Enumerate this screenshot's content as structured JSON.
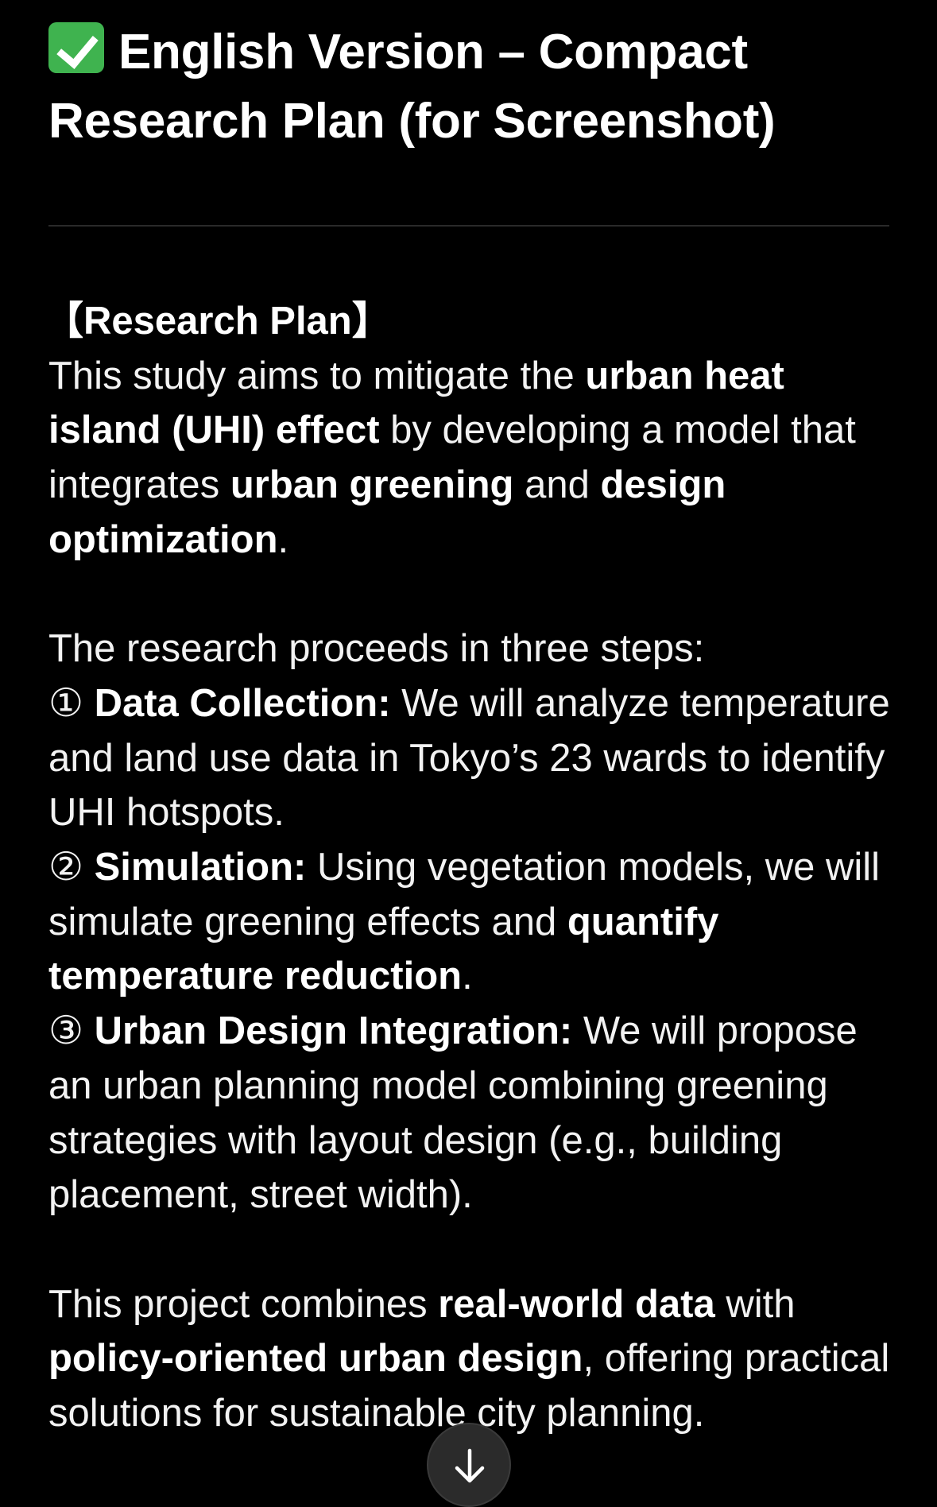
{
  "header": {
    "title": "English Version – Compact Research Plan (for Screenshot)",
    "icon": "check-mark-emoji-icon"
  },
  "section": {
    "label": "【Research Plan】",
    "intro": {
      "t1": "This study aims to mitigate the ",
      "b1": "urban heat island (UHI) effect",
      "t2": " by developing a model that integrates ",
      "b2": "urban greening",
      "t3": " and ",
      "b3": "design optimization",
      "t4": "."
    },
    "steps_intro": "The research proceeds in three steps:",
    "steps": [
      {
        "marker": "①",
        "title": "Data Collection:",
        "text": " We will analyze temperature and land use data in Tokyo’s 23 wards to identify UHI hotspots."
      },
      {
        "marker": "②",
        "title": "Simulation:",
        "text": " Using vegetation models, we will simulate greening effects and ",
        "bold": "quantify temperature reduction",
        "end": "."
      },
      {
        "marker": "③",
        "title": "Urban Design Integration:",
        "text": " We will propose an urban planning model combining greening strategies with layout design (e.g., building placement, street width)."
      }
    ],
    "conclusion": {
      "t1": "This project combines ",
      "b1": "real-world data",
      "t2": " with ",
      "b2": "policy-oriented urban design",
      "t3": ", offering practical solutions for sustainable city planning."
    }
  },
  "controls": {
    "scroll_down_icon": "arrow-down-icon"
  },
  "colors": {
    "background": "#000000",
    "text": "#f2f2f2",
    "check": "#3fb34f"
  }
}
